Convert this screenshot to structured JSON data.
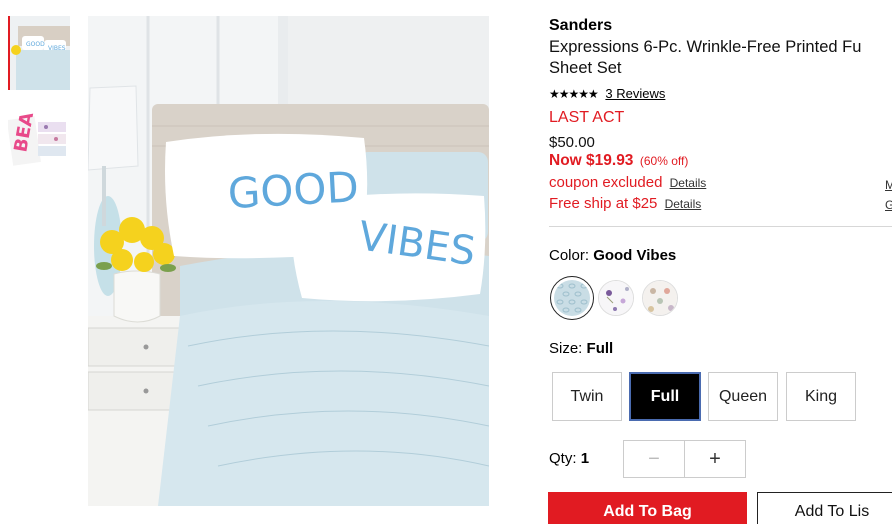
{
  "product": {
    "brand": "Sanders",
    "title_line1": "Expressions 6-Pc. Wrinkle-Free Printed Fu",
    "title_line2": "Sheet Set",
    "stars": "★★★★★",
    "reviews": "3 Reviews",
    "badge": "LAST ACT",
    "original_price": "$50.00",
    "sale_price": "Now $19.93",
    "percent_off": "(60% off)",
    "coupon_text": "coupon excluded",
    "coupon_details": "Details",
    "shipping_text": "Free ship at $25",
    "shipping_details": "Details",
    "edge_link_1": "M",
    "edge_link_2": "G"
  },
  "images": {
    "pillow_text_1": "GOOD",
    "pillow_text_2": "VIBES",
    "thumb2_text": "BEA"
  },
  "color": {
    "label": "Color:",
    "selected": "Good Vibes",
    "swatches": [
      "good-vibes",
      "floral",
      "dots"
    ]
  },
  "size": {
    "label": "Size:",
    "selected": "Full",
    "options": [
      "Twin",
      "Full",
      "Queen",
      "King"
    ]
  },
  "quantity": {
    "label": "Qty:",
    "value": "1",
    "minus": "−",
    "plus": "+"
  },
  "actions": {
    "add_to_bag": "Add To Bag",
    "add_to_list": "Add To Lis"
  },
  "colors": {
    "accent_red": "#e11b22",
    "pillow_blue": "#5fa8dc",
    "sheet_blue": "#cfe2ea"
  }
}
